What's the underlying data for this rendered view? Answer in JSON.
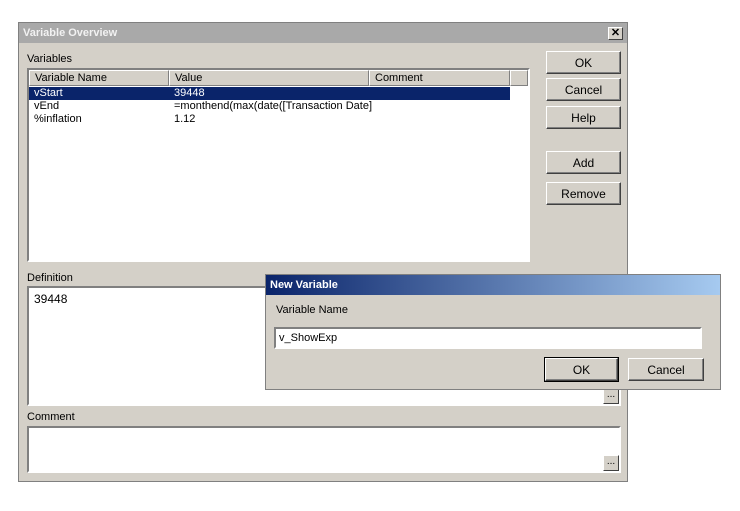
{
  "window": {
    "title": "Variable Overview",
    "close_glyph": "✕",
    "variables_label": "Variables",
    "columns": [
      "Variable Name",
      "Value",
      "Comment"
    ],
    "rows": [
      {
        "name": "vStart",
        "value": "39448",
        "comment": ""
      },
      {
        "name": "vEnd",
        "value": "=monthend(max(date([Transaction Date]",
        "comment": ""
      },
      {
        "name": "%inflation",
        "value": "1.12",
        "comment": ""
      }
    ],
    "definition_label": "Definition",
    "definition_value": "39448",
    "comment_label": "Comment",
    "comment_value": "",
    "ellipsis": "...",
    "buttons": {
      "ok": "OK",
      "cancel": "Cancel",
      "help": "Help",
      "add": "Add",
      "remove": "Remove"
    }
  },
  "new_variable_dialog": {
    "title": "New Variable",
    "name_label": "Variable Name",
    "name_value": "v_ShowExp",
    "ok": "OK",
    "cancel": "Cancel"
  },
  "colors": {
    "selection": "#0a246a",
    "face": "#d4d0c8",
    "inactive_title": "#a9a9a9"
  }
}
